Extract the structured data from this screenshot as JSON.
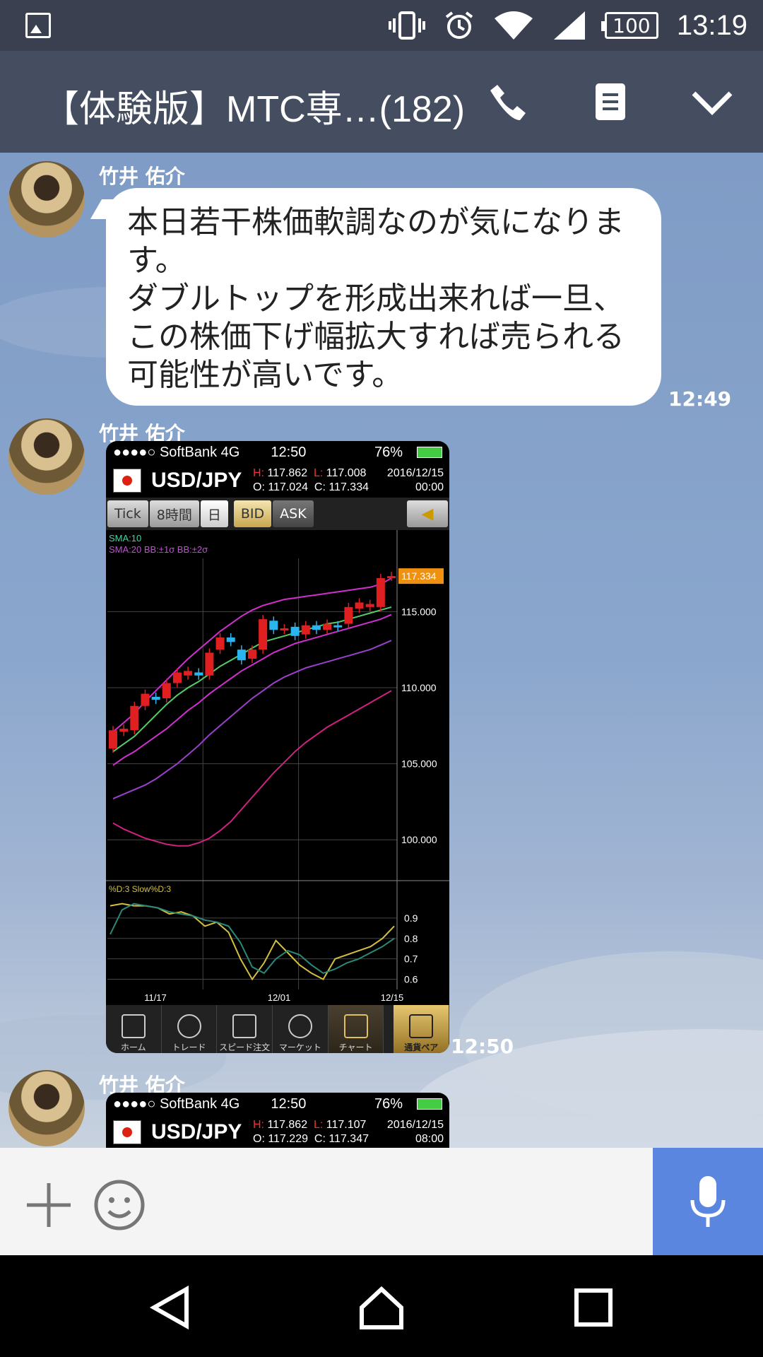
{
  "status_bar": {
    "battery": "100",
    "time": "13:19"
  },
  "header": {
    "title": "【体験版】MTC専…(182)"
  },
  "messages": [
    {
      "sender": "竹井 佑介",
      "text": "本日若干株価軟調なのが気になります。\nダブルトップを形成出来れば一旦、\nこの株価下げ幅拡大すれば売られる\n可能性が高いです。",
      "time": "12:49"
    },
    {
      "sender": "竹井 佑介",
      "time": "12:50",
      "screenshot": {
        "carrier": "●●●●○ SoftBank  4G",
        "clock": "12:50",
        "battery": "76%",
        "pair": "USD/JPY",
        "h_label": "H:",
        "h": "117.862",
        "l_label": "L:",
        "l": "117.008",
        "o_label": "O:",
        "o": "117.024",
        "c_label": "C:",
        "c": "117.334",
        "date": "2016/12/15",
        "hour": "00:00",
        "tabs": [
          "Tick",
          "8時間",
          "日"
        ],
        "bid": "BID",
        "ask": "ASK",
        "legend1": "SMA:10",
        "legend2": "SMA:20  BB:±1σ  BB:±2σ",
        "osc_legend": "%D:3   Slow%D:3",
        "bottom_tabs": [
          "ホーム",
          "トレード",
          "スピード注文",
          "マーケット",
          "チャート",
          "通貨ペア"
        ]
      }
    },
    {
      "sender": "竹井 佑介",
      "screenshot": {
        "carrier": "●●●●○ SoftBank  4G",
        "clock": "12:50",
        "battery": "76%",
        "pair": "USD/JPY",
        "h_label": "H:",
        "h": "117.862",
        "l_label": "L:",
        "l": "117.107",
        "o_label": "O:",
        "o": "117.229",
        "c_label": "C:",
        "c": "117.347",
        "date": "2016/12/15",
        "hour": "08:00"
      }
    }
  ],
  "chart_data": {
    "type": "line",
    "title": "",
    "price_axis": [
      115.0,
      110.0,
      105.0,
      100.0
    ],
    "current_price": "117.334",
    "osc_axis": [
      0.9,
      0.8,
      0.7,
      0.6
    ],
    "x_ticks": [
      "11/17",
      "12/01",
      "12/15"
    ],
    "ylim": [
      97.5,
      118.5
    ],
    "candles": [
      {
        "o": 106.0,
        "c": 107.2
      },
      {
        "o": 107.1,
        "c": 107.3
      },
      {
        "o": 107.2,
        "c": 108.8
      },
      {
        "o": 108.8,
        "c": 109.6
      },
      {
        "o": 109.4,
        "c": 109.2
      },
      {
        "o": 109.3,
        "c": 110.3
      },
      {
        "o": 110.3,
        "c": 111.0
      },
      {
        "o": 110.8,
        "c": 111.1
      },
      {
        "o": 111.0,
        "c": 110.8
      },
      {
        "o": 110.8,
        "c": 112.3
      },
      {
        "o": 112.5,
        "c": 113.3
      },
      {
        "o": 113.3,
        "c": 113.0
      },
      {
        "o": 112.5,
        "c": 111.8
      },
      {
        "o": 111.9,
        "c": 112.5
      },
      {
        "o": 112.5,
        "c": 114.5
      },
      {
        "o": 114.4,
        "c": 113.8
      },
      {
        "o": 113.8,
        "c": 113.9
      },
      {
        "o": 114.0,
        "c": 113.4
      },
      {
        "o": 113.5,
        "c": 114.1
      },
      {
        "o": 114.1,
        "c": 113.8
      },
      {
        "o": 113.8,
        "c": 114.2
      },
      {
        "o": 114.1,
        "c": 114.0
      },
      {
        "o": 114.2,
        "c": 115.3
      },
      {
        "o": 115.2,
        "c": 115.6
      },
      {
        "o": 115.3,
        "c": 115.5
      },
      {
        "o": 115.3,
        "c": 117.2
      },
      {
        "o": 117.3,
        "c": 117.334
      }
    ],
    "series": [
      {
        "values": [
          105.8,
          106.3,
          106.8,
          107.5,
          108.2,
          108.9,
          109.5,
          110.0,
          110.4,
          110.9,
          111.4,
          111.8,
          112.2,
          112.6,
          113.0,
          113.2,
          113.4,
          113.6,
          113.8,
          114.0,
          114.2,
          114.3,
          114.5,
          114.7,
          114.9,
          115.1,
          115.3
        ],
        "color": "#55cc66"
      },
      {
        "values": [
          104.9,
          105.4,
          105.8,
          106.3,
          106.8,
          107.3,
          107.9,
          108.5,
          109.0,
          109.6,
          110.1,
          110.6,
          111.1,
          111.5,
          111.9,
          112.3,
          112.6,
          112.9,
          113.1,
          113.3,
          113.5,
          113.7,
          113.9,
          114.1,
          114.3,
          114.5,
          114.8
        ],
        "color": "#d030d0"
      },
      {
        "values": [
          107.1,
          107.7,
          108.3,
          109.1,
          109.8,
          110.5,
          111.2,
          111.9,
          112.5,
          113.1,
          113.7,
          114.2,
          114.7,
          115.1,
          115.4,
          115.6,
          115.8,
          115.9,
          116.0,
          116.1,
          116.2,
          116.3,
          116.4,
          116.5,
          116.6,
          116.8,
          117.2
        ],
        "color": "#d030d0"
      },
      {
        "values": [
          102.7,
          103.0,
          103.3,
          103.6,
          104.0,
          104.5,
          105.0,
          105.6,
          106.2,
          106.9,
          107.5,
          108.1,
          108.7,
          109.3,
          109.8,
          110.3,
          110.7,
          111.0,
          111.3,
          111.5,
          111.7,
          111.9,
          112.1,
          112.3,
          112.5,
          112.8,
          113.1
        ],
        "color": "#9a40cc"
      },
      {
        "values": [
          101.1,
          100.7,
          100.4,
          100.1,
          99.9,
          99.7,
          99.6,
          99.6,
          99.8,
          100.1,
          100.6,
          101.2,
          102.0,
          102.8,
          103.6,
          104.4,
          105.1,
          105.8,
          106.4,
          106.9,
          107.4,
          107.8,
          108.2,
          108.6,
          109.0,
          109.4,
          109.8
        ],
        "color": "#d02080"
      }
    ],
    "oscillator": [
      {
        "name": "%D:3",
        "color": "#d4c040",
        "values": [
          0.96,
          0.97,
          0.96,
          0.96,
          0.95,
          0.92,
          0.93,
          0.91,
          0.86,
          0.88,
          0.83,
          0.7,
          0.6,
          0.68,
          0.79,
          0.73,
          0.67,
          0.63,
          0.6,
          0.7,
          0.72,
          0.74,
          0.76,
          0.8,
          0.86
        ]
      },
      {
        "name": "Slow%D:3",
        "color": "#2a8a7a",
        "values": [
          0.82,
          0.94,
          0.97,
          0.96,
          0.95,
          0.93,
          0.92,
          0.91,
          0.89,
          0.88,
          0.86,
          0.78,
          0.66,
          0.63,
          0.7,
          0.74,
          0.72,
          0.67,
          0.63,
          0.65,
          0.68,
          0.7,
          0.73,
          0.76,
          0.8
        ]
      }
    ]
  }
}
